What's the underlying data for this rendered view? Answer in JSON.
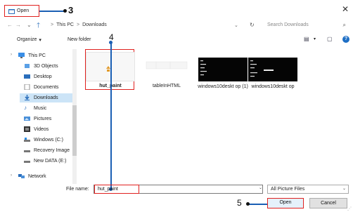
{
  "title_bar": {
    "title": "Open",
    "close_glyph": "✕"
  },
  "annotations": {
    "step3": "3",
    "step4": "4",
    "step5": "5"
  },
  "address_bar": {
    "breadcrumb": [
      "This PC",
      "Downloads"
    ],
    "separator": ">",
    "search_placeholder": "Search Downloads"
  },
  "toolbar": {
    "organize_label": "Organize",
    "new_folder_label": "New folder"
  },
  "sidebar": {
    "items": [
      {
        "label": "This PC",
        "icon": "pc-icon"
      },
      {
        "label": "3D Objects",
        "icon": "cube-icon"
      },
      {
        "label": "Desktop",
        "icon": "desktop-icon"
      },
      {
        "label": "Documents",
        "icon": "documents-icon"
      },
      {
        "label": "Downloads",
        "icon": "download-icon",
        "selected": true
      },
      {
        "label": "Music",
        "icon": "music-icon"
      },
      {
        "label": "Pictures",
        "icon": "pictures-icon"
      },
      {
        "label": "Videos",
        "icon": "videos-icon"
      },
      {
        "label": "Windows (C:)",
        "icon": "drive-icon"
      },
      {
        "label": "Recovery Image",
        "icon": "drive-icon"
      },
      {
        "label": "New DATA (E:)",
        "icon": "drive-icon"
      },
      {
        "label": "Network",
        "icon": "network-icon"
      }
    ]
  },
  "files": [
    {
      "name": "hut_paint",
      "selected": true
    },
    {
      "name": "tableInHTML"
    },
    {
      "name": "windows10deskt op (1)"
    },
    {
      "name": "windows10deskt op"
    }
  ],
  "bottom": {
    "file_name_label": "File name:",
    "file_name_value": "hut_paint",
    "file_type_value": "All Picture Files",
    "open_label": "Open",
    "cancel_label": "Cancel"
  },
  "colors": {
    "highlight_red": "#e0211f",
    "accent_blue": "#1a5fb4",
    "selection_bg": "#cce4f7"
  }
}
